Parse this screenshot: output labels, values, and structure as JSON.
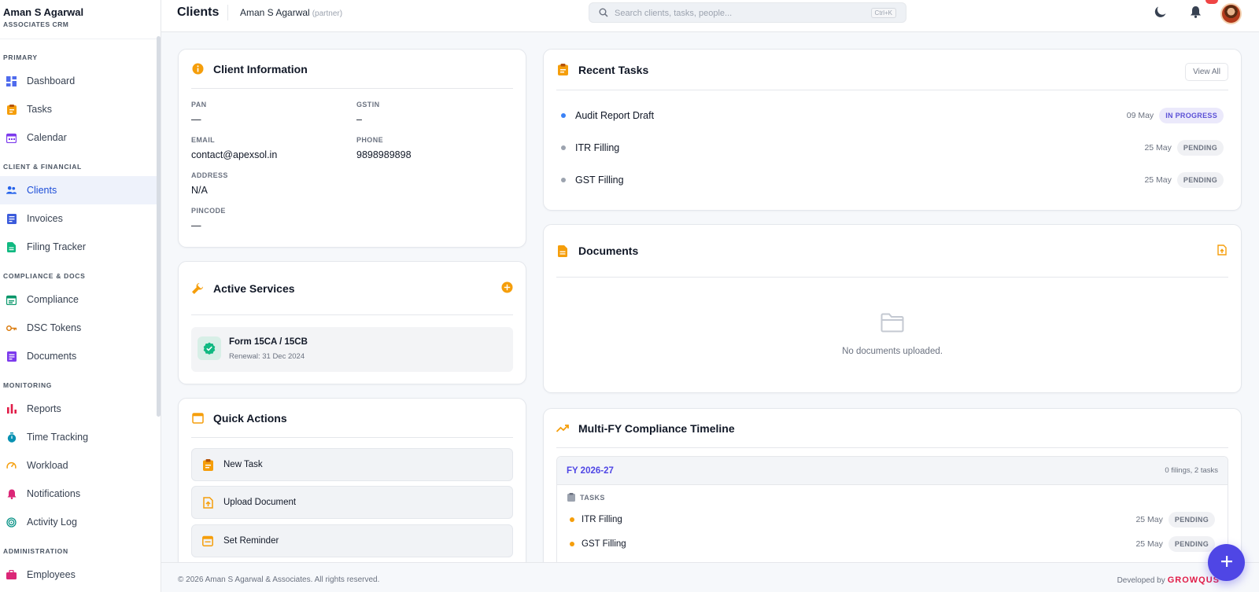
{
  "brand": {
    "name": "Aman S Agarwal",
    "sub": "ASSOCIATES CRM"
  },
  "sidebar": {
    "sections": [
      {
        "title": "PRIMARY",
        "items": [
          {
            "label": "Dashboard",
            "icon": "dashboard-icon"
          },
          {
            "label": "Tasks",
            "icon": "clipboard-icon"
          },
          {
            "label": "Calendar",
            "icon": "calendar-icon"
          }
        ]
      },
      {
        "title": "CLIENT & FINANCIAL",
        "items": [
          {
            "label": "Clients",
            "icon": "users-icon",
            "active": true
          },
          {
            "label": "Invoices",
            "icon": "invoice-icon"
          },
          {
            "label": "Filing Tracker",
            "icon": "file-icon"
          }
        ]
      },
      {
        "title": "COMPLIANCE & DOCS",
        "items": [
          {
            "label": "Compliance",
            "icon": "calendar-check-icon"
          },
          {
            "label": "DSC Tokens",
            "icon": "key-icon"
          },
          {
            "label": "Documents",
            "icon": "document-icon"
          }
        ]
      },
      {
        "title": "MONITORING",
        "items": [
          {
            "label": "Reports",
            "icon": "bar-chart-icon"
          },
          {
            "label": "Time Tracking",
            "icon": "stopwatch-icon"
          },
          {
            "label": "Workload",
            "icon": "gauge-icon"
          },
          {
            "label": "Notifications",
            "icon": "bell-icon"
          },
          {
            "label": "Activity Log",
            "icon": "fingerprint-icon"
          }
        ]
      },
      {
        "title": "ADMINISTRATION",
        "items": [
          {
            "label": "Employees",
            "icon": "briefcase-icon"
          }
        ]
      }
    ]
  },
  "topbar": {
    "title": "Clients",
    "user": "Aman S Agarwal",
    "role": "(partner)",
    "search_placeholder": "Search clients, tasks, people...",
    "shortcut": "Ctrl+K"
  },
  "client_info": {
    "title": "Client Information",
    "fields": {
      "pan": {
        "label": "PAN",
        "value": "—"
      },
      "gstin": {
        "label": "GSTIN",
        "value": "–"
      },
      "email": {
        "label": "EMAIL",
        "value": "contact@apexsol.in"
      },
      "phone": {
        "label": "PHONE",
        "value": "9898989898"
      },
      "address": {
        "label": "ADDRESS",
        "value": "N/A"
      },
      "pincode": {
        "label": "PINCODE",
        "value": "—"
      }
    }
  },
  "services": {
    "title": "Active Services",
    "items": [
      {
        "name": "Form 15CA / 15CB",
        "renewal": "Renewal: 31 Dec 2024"
      }
    ]
  },
  "quick_actions": {
    "title": "Quick Actions",
    "items": [
      {
        "label": "New Task",
        "icon": "clipboard-icon"
      },
      {
        "label": "Upload Document",
        "icon": "file-upload-icon"
      },
      {
        "label": "Set Reminder",
        "icon": "calendar-icon"
      }
    ]
  },
  "recent_tasks": {
    "title": "Recent Tasks",
    "view_all": "View All",
    "items": [
      {
        "name": "Audit Report Draft",
        "date": "09 May",
        "status": "IN PROGRESS",
        "dot": "#3b82f6"
      },
      {
        "name": "ITR Filling",
        "date": "25 May",
        "status": "PENDING",
        "dot": "#9ca3af"
      },
      {
        "name": "GST Filling",
        "date": "25 May",
        "status": "PENDING",
        "dot": "#9ca3af"
      }
    ]
  },
  "documents": {
    "title": "Documents",
    "empty": "No documents uploaded."
  },
  "timeline": {
    "title": "Multi-FY Compliance Timeline",
    "fy": "FY 2026-27",
    "count": "0 filings, 2 tasks",
    "tasks_label": "TASKS",
    "items": [
      {
        "name": "ITR Filling",
        "date": "25 May",
        "status": "PENDING"
      },
      {
        "name": "GST Filling",
        "date": "25 May",
        "status": "PENDING"
      }
    ]
  },
  "footer": {
    "copyright": "© 2026 Aman S Agarwal & Associates. All rights reserved.",
    "developed_by": "Developed by",
    "dev_logo": "GROWQUS"
  },
  "colors": {
    "accent": "#4f46e5",
    "orange": "#f59e0b",
    "active_bg": "#eef2fb"
  }
}
